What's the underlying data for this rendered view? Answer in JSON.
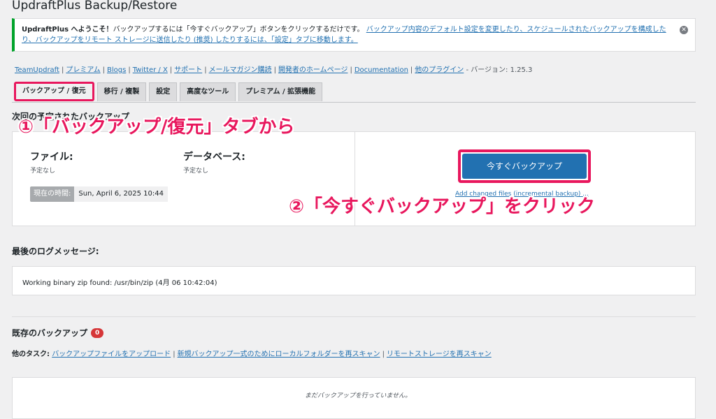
{
  "page": {
    "title": "UpdraftPlus Backup/Restore"
  },
  "notice": {
    "strong": "UpdraftPlus へようこそ！",
    "text": "バックアップするには「今すぐバックアップ」ボタンをクリックするだけです。",
    "link": "バックアップ内容のデフォルト設定を変更したり、スケジュールされたバックアップを構成したり、バックアップをリモート ストレージに送信したり (推奨) したりするには、「設定」タブに移動します。"
  },
  "links": {
    "items": [
      "TeamUpdraft",
      "プレミアム",
      "Blogs",
      "Twitter / X",
      "サポート",
      "メールマガジン購読",
      "開発者のホームページ",
      "Documentation",
      "他のプラグイン"
    ],
    "version": "- バージョン: 1.25.3"
  },
  "tabs": [
    {
      "label": "バックアップ / 復元",
      "active": true
    },
    {
      "label": "移行 / 複製",
      "active": false
    },
    {
      "label": "設定",
      "active": false
    },
    {
      "label": "高度なツール",
      "active": false
    },
    {
      "label": "プレミアム / 拡張機能",
      "active": false
    }
  ],
  "next_backup": {
    "heading": "次回の予定されたバックアップ",
    "files_title": "ファイル:",
    "files_value": "予定なし",
    "db_title": "データベース:",
    "db_value": "予定なし",
    "time_label": "現在の時間:",
    "time_value": "Sun, April 6, 2025 10:44",
    "backup_now": "今すぐバックアップ",
    "incremental": "Add changed files (incremental backup) ..."
  },
  "annotations": {
    "step1": "①「バックアップ/復元」タブから",
    "step2": "②「今すぐバックアップ」をクリック",
    "color": "#e8175d"
  },
  "log": {
    "heading": "最後のログメッセージ:",
    "message": "Working binary zip found: /usr/bin/zip (4月 06 10:42:04)"
  },
  "existing": {
    "heading": "既存のバックアップ",
    "count": "0",
    "tasks_label": "他のタスク:",
    "tasks": [
      "バックアップファイルをアップロード",
      "新規バックアップ一式のためにローカルフォルダーを再スキャン",
      "リモートストレージを再スキャン"
    ],
    "empty": "まだバックアップを行っていません。"
  },
  "colors": {
    "primary": "#2271b1",
    "success_border": "#00a32a",
    "badge": "#d63638"
  }
}
